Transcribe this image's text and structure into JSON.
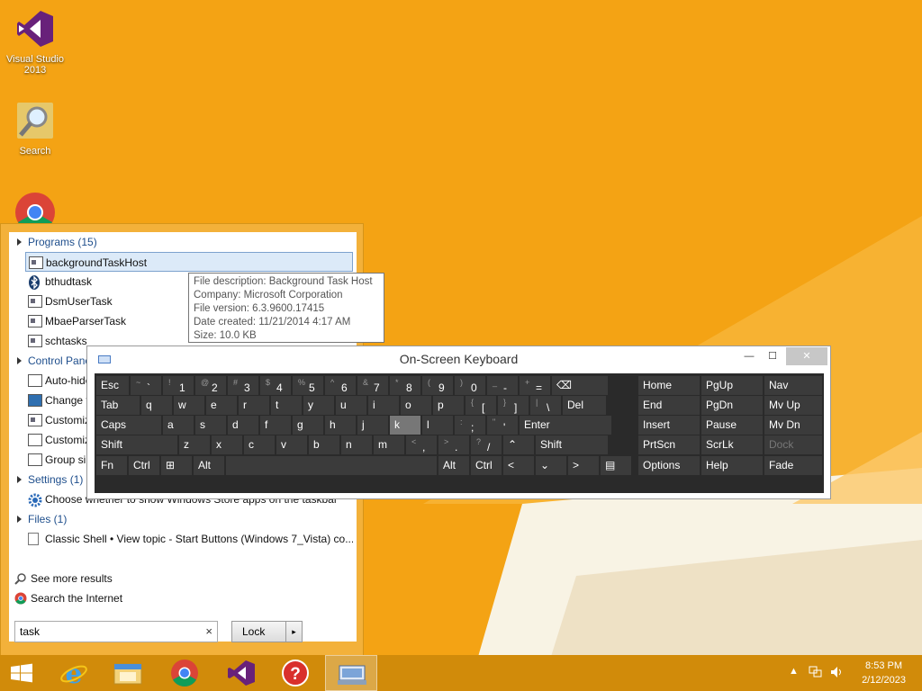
{
  "desktop": {
    "icons": [
      {
        "label": "Visual Studio 2013",
        "icon": "visual-studio-icon"
      },
      {
        "label": "Search",
        "icon": "search-icon"
      },
      {
        "label": "",
        "icon": "chrome-icon"
      }
    ]
  },
  "start_menu": {
    "programs_header": "Programs (15)",
    "programs": [
      {
        "label": "backgroundTaskHost",
        "icon": "window-icon",
        "selected": true
      },
      {
        "label": "bthudtask",
        "icon": "bluetooth-icon"
      },
      {
        "label": "DsmUserTask",
        "icon": "window-icon"
      },
      {
        "label": "MbaeParserTask",
        "icon": "window-icon"
      },
      {
        "label": "schtasks",
        "icon": "window-icon"
      }
    ],
    "control_panel_header": "Control Panel",
    "control_panel": [
      {
        "label": "Auto-hide the taskbar",
        "icon": "checkbox-icon"
      },
      {
        "label": "Change the taskbar",
        "icon": "monitor-icon"
      },
      {
        "label": "Customize",
        "icon": "window-icon"
      },
      {
        "label": "Customize",
        "icon": "checkbox-icon"
      },
      {
        "label": "Group similar",
        "icon": "checkbox-icon"
      }
    ],
    "settings_header": "Settings (1)",
    "settings": [
      {
        "label": "Choose whether to show Windows Store apps on the taskbar",
        "icon": "gear-icon"
      }
    ],
    "files_header": "Files (1)",
    "files": [
      {
        "label": "Classic Shell • View topic - Start Buttons (Windows 7_Vista) co...",
        "icon": "document-icon"
      }
    ],
    "see_more": "See more results",
    "search_internet": "Search the Internet",
    "search_value": "task",
    "lock_label": "Lock",
    "clear_glyph": "×",
    "arrow_glyph": "▸"
  },
  "tooltip": {
    "lines": [
      "File description: Background Task Host",
      "Company: Microsoft Corporation",
      "File version: 6.3.9600.17415",
      "Date created: 11/21/2014 4:17 AM",
      "Size: 10.0 KB"
    ]
  },
  "osk": {
    "title": "On-Screen Keyboard",
    "minimize": "—",
    "maximize": "☐",
    "close": "✕",
    "rows": [
      [
        {
          "l": "Esc"
        },
        {
          "a": "~",
          "l": "`"
        },
        {
          "a": "!",
          "l": "1"
        },
        {
          "a": "@",
          "l": "2"
        },
        {
          "a": "#",
          "l": "3"
        },
        {
          "a": "$",
          "l": "4"
        },
        {
          "a": "%",
          "l": "5"
        },
        {
          "a": "^",
          "l": "6"
        },
        {
          "a": "&",
          "l": "7"
        },
        {
          "a": "*",
          "l": "8"
        },
        {
          "a": "(",
          "l": "9"
        },
        {
          "a": ")",
          "l": "0"
        },
        {
          "a": "_",
          "l": "-"
        },
        {
          "a": "+",
          "l": "="
        },
        {
          "l": "⌫"
        }
      ],
      [
        {
          "l": "Tab"
        },
        {
          "l": "q"
        },
        {
          "l": "w"
        },
        {
          "l": "e"
        },
        {
          "l": "r"
        },
        {
          "l": "t"
        },
        {
          "l": "y"
        },
        {
          "l": "u"
        },
        {
          "l": "i"
        },
        {
          "l": "o"
        },
        {
          "l": "p"
        },
        {
          "a": "{",
          "l": "["
        },
        {
          "a": "}",
          "l": "]"
        },
        {
          "a": "|",
          "l": "\\"
        },
        {
          "l": "Del"
        }
      ],
      [
        {
          "l": "Caps"
        },
        {
          "l": "a"
        },
        {
          "l": "s"
        },
        {
          "l": "d"
        },
        {
          "l": "f"
        },
        {
          "l": "g"
        },
        {
          "l": "h"
        },
        {
          "l": "j"
        },
        {
          "l": "k"
        },
        {
          "l": "l"
        },
        {
          "a": ":",
          "l": ";"
        },
        {
          "a": "\"",
          "l": "'"
        },
        {
          "l": "Enter"
        }
      ],
      [
        {
          "l": "Shift"
        },
        {
          "l": "z"
        },
        {
          "l": "x"
        },
        {
          "l": "c"
        },
        {
          "l": "v"
        },
        {
          "l": "b"
        },
        {
          "l": "n"
        },
        {
          "l": "m"
        },
        {
          "a": "<",
          "l": ","
        },
        {
          "a": ">",
          "l": "."
        },
        {
          "a": "?",
          "l": "/"
        },
        {
          "l": "⌃"
        },
        {
          "l": "Shift"
        }
      ],
      [
        {
          "l": "Fn"
        },
        {
          "l": "Ctrl"
        },
        {
          "l": "⊞"
        },
        {
          "l": "Alt"
        },
        {
          "l": ""
        },
        {
          "l": "Alt"
        },
        {
          "l": "Ctrl"
        },
        {
          "l": "<"
        },
        {
          "l": "⌄"
        },
        {
          "l": ">"
        },
        {
          "l": "▤"
        }
      ]
    ],
    "nav_keys": [
      [
        "Home",
        "PgUp",
        "Nav"
      ],
      [
        "End",
        "PgDn",
        "Mv Up"
      ],
      [
        "Insert",
        "Pause",
        "Mv Dn"
      ],
      [
        "PrtScn",
        "ScrLk",
        "Dock"
      ],
      [
        "Options",
        "Help",
        "Fade"
      ]
    ],
    "pressed_key": "k",
    "disabled_key": "Dock"
  },
  "taskbar": {
    "apps": [
      "start-icon",
      "internet-explorer-icon",
      "file-explorer-icon",
      "chrome-icon",
      "visual-studio-icon",
      "help-icon",
      "on-screen-keyboard-icon"
    ],
    "active_app": "on-screen-keyboard-icon",
    "time": "8:53 PM",
    "date": "2/12/2023"
  }
}
